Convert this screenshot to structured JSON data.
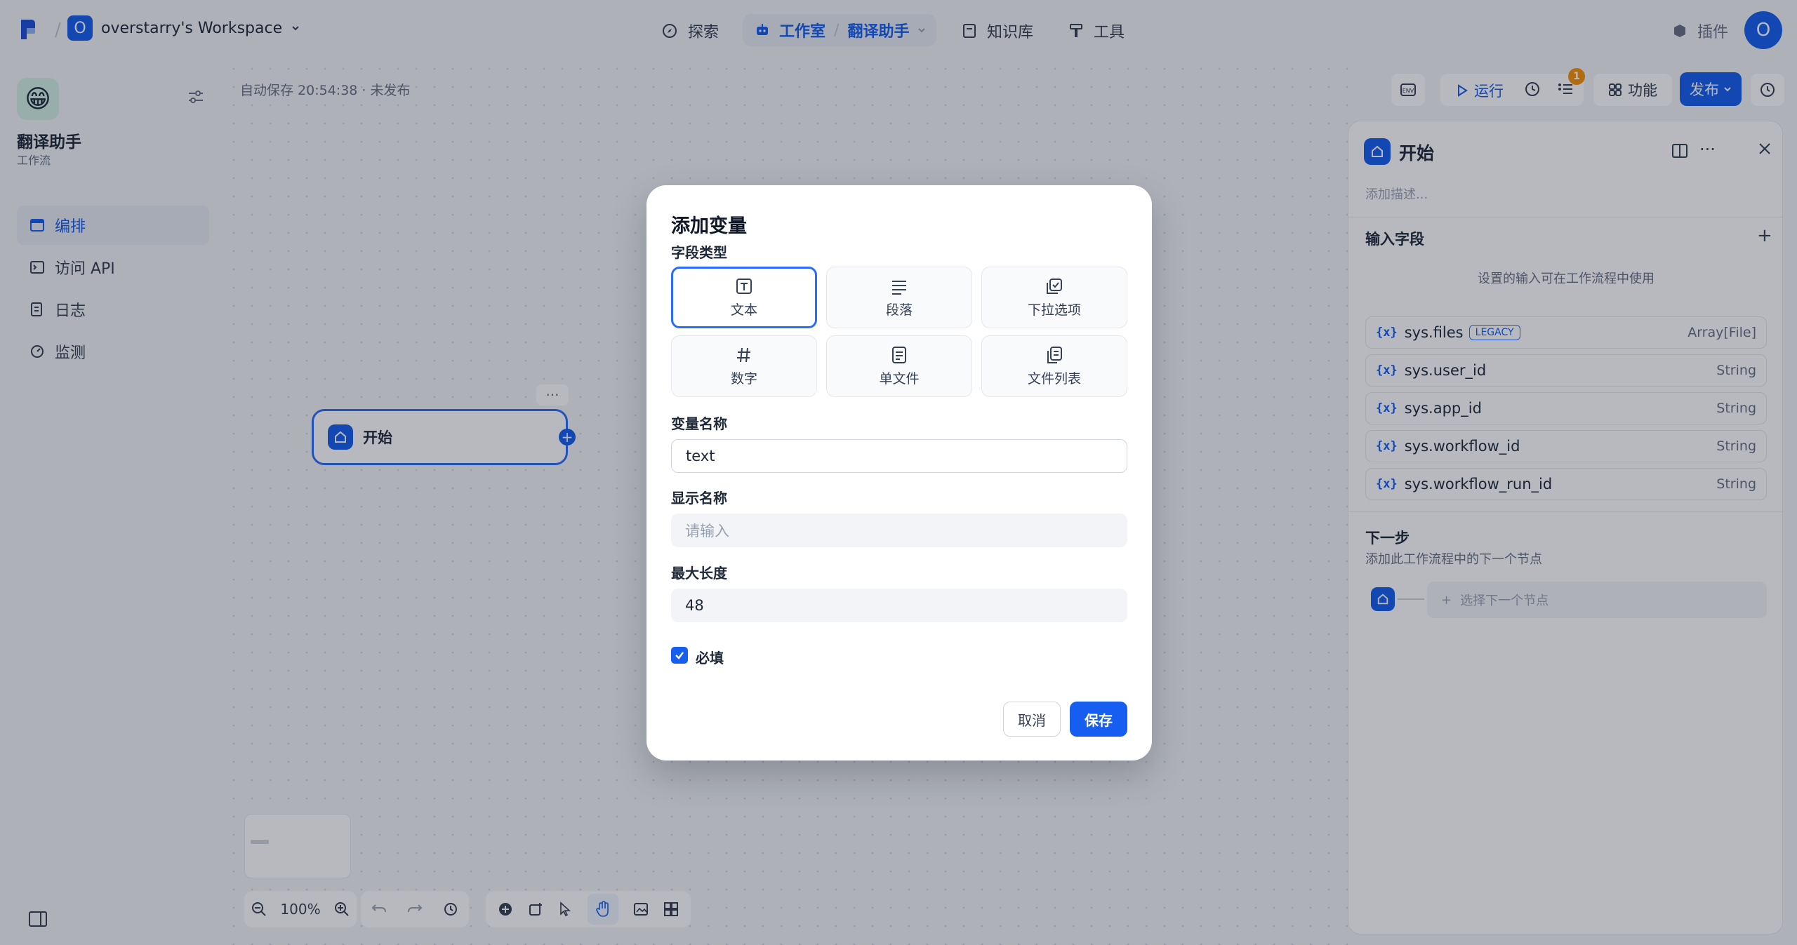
{
  "topbar": {
    "workspace_initial": "O",
    "workspace_name": "overstarry's Workspace",
    "nav": {
      "explore": "探索",
      "studio": "工作室",
      "app_name": "翻译助手",
      "knowledge": "知识库",
      "tools": "工具"
    },
    "plugins": "插件",
    "user_initial": "O"
  },
  "sidebar": {
    "app_title": "翻译助手",
    "app_type": "工作流",
    "items": [
      {
        "label": "编排",
        "icon": "layout-icon",
        "active": true
      },
      {
        "label": "访问 API",
        "icon": "terminal-icon",
        "active": false
      },
      {
        "label": "日志",
        "icon": "log-icon",
        "active": false
      },
      {
        "label": "监测",
        "icon": "monitor-icon",
        "active": false
      }
    ]
  },
  "workflow": {
    "autosave": "自动保存 20:54:38 · 未发布",
    "start_node_label": "开始",
    "run_label": "运行",
    "checklist_badge": "1",
    "features_label": "功能",
    "publish_label": "发布",
    "zoom": "100%"
  },
  "panel": {
    "title": "开始",
    "desc_placeholder": "添加描述...",
    "input_fields_title": "输入字段",
    "input_hint": "设置的输入可在工作流程中使用",
    "sys_vars": [
      {
        "name": "sys.files",
        "badge": "LEGACY",
        "type": "Array[File]"
      },
      {
        "name": "sys.user_id",
        "badge": "",
        "type": "String"
      },
      {
        "name": "sys.app_id",
        "badge": "",
        "type": "String"
      },
      {
        "name": "sys.workflow_id",
        "badge": "",
        "type": "String"
      },
      {
        "name": "sys.workflow_run_id",
        "badge": "",
        "type": "String"
      }
    ],
    "next_step_title": "下一步",
    "next_step_desc": "添加此工作流程中的下一个节点",
    "next_step_placeholder": "选择下一个节点"
  },
  "modal": {
    "title": "添加变量",
    "field_type_label": "字段类型",
    "types": [
      {
        "label": "文本",
        "icon": "text-type-icon",
        "selected": true
      },
      {
        "label": "段落",
        "icon": "paragraph-icon",
        "selected": false
      },
      {
        "label": "下拉选项",
        "icon": "select-icon",
        "selected": false
      },
      {
        "label": "数字",
        "icon": "number-icon",
        "selected": false
      },
      {
        "label": "单文件",
        "icon": "file-icon",
        "selected": false
      },
      {
        "label": "文件列表",
        "icon": "file-list-icon",
        "selected": false
      }
    ],
    "var_name_label": "变量名称",
    "var_name_value": "text",
    "display_name_label": "显示名称",
    "display_name_placeholder": "请输入",
    "max_length_label": "最大长度",
    "max_length_value": "48",
    "required_label": "必填",
    "required_checked": true,
    "cancel_label": "取消",
    "save_label": "保存"
  },
  "colors": {
    "accent": "#155eef",
    "bg": "#f2f4f7",
    "badge": "#f79009"
  }
}
